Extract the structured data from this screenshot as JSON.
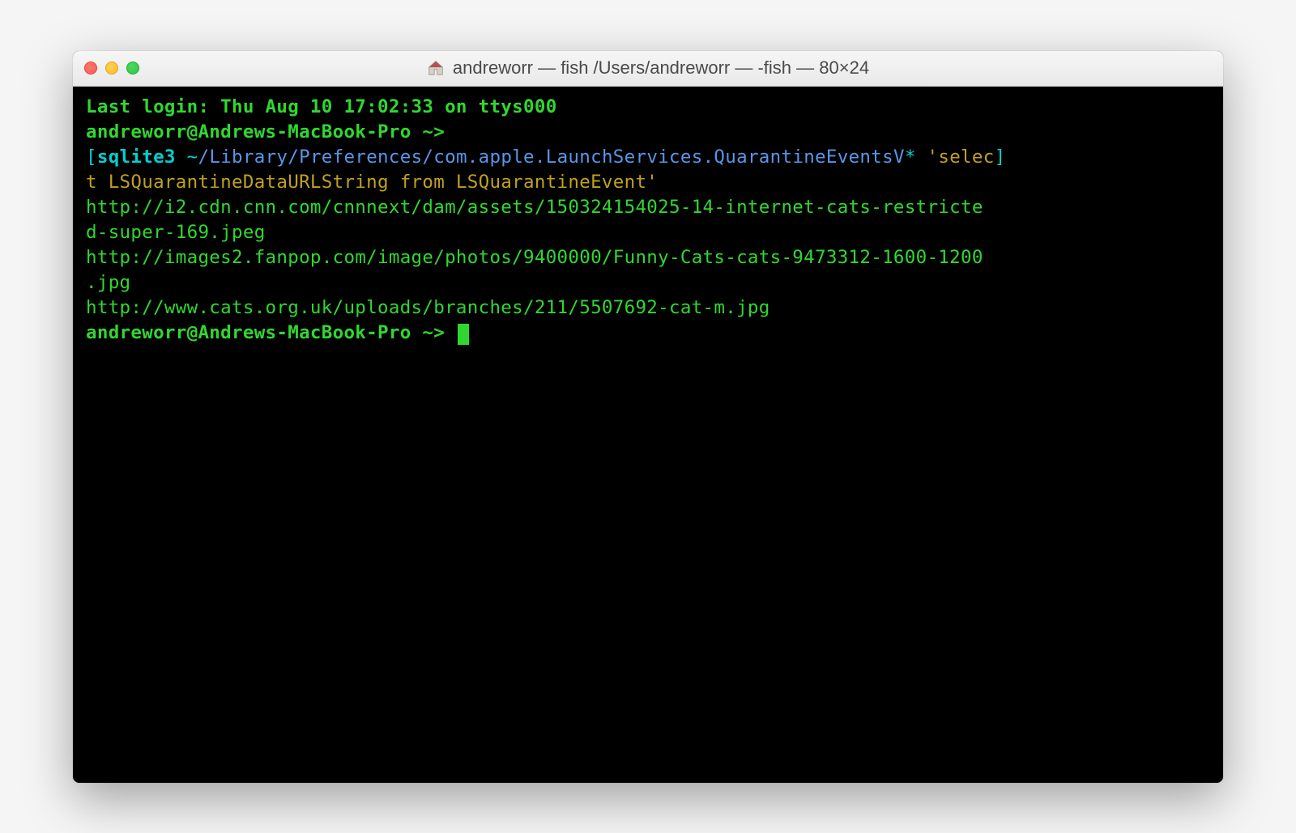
{
  "titlebar": {
    "home_icon": "🏠",
    "title": "andreworr — fish  /Users/andreworr — -fish — 80×24"
  },
  "terminal": {
    "last_login": "Last login: Thu Aug 10 17:02:33 on ttys000",
    "prompt1": "andreworr@Andrews-MacBook-Pro ~>",
    "bracket_open": "[",
    "bracket_close": "]",
    "cmd_sqlite": "sqlite3",
    "cmd_path_tilde": " ~",
    "cmd_path_rest": "/Library/Preferences/com.apple.LaunchServices.QuarantineEventsV",
    "cmd_star": "*",
    "cmd_quote1": " 'selec",
    "cmd_quote2": "t LSQuarantineDataURLString from LSQuarantineEvent'",
    "output_line1": "http://i2.cdn.cnn.com/cnnnext/dam/assets/150324154025-14-internet-cats-restricte",
    "output_line2": "d-super-169.jpeg",
    "output_line3": "http://images2.fanpop.com/image/photos/9400000/Funny-Cats-cats-9473312-1600-1200",
    "output_line4": ".jpg",
    "output_line5": "http://www.cats.org.uk/uploads/branches/211/5507692-cat-m.jpg",
    "prompt2": "andreworr@Andrews-MacBook-Pro ~> "
  },
  "colors": {
    "green_bright": "#2fd82f",
    "cyan": "#00d0d0",
    "path_blue": "#5896e8",
    "cmd_yellow": "#c0a020",
    "bg": "#000000"
  }
}
